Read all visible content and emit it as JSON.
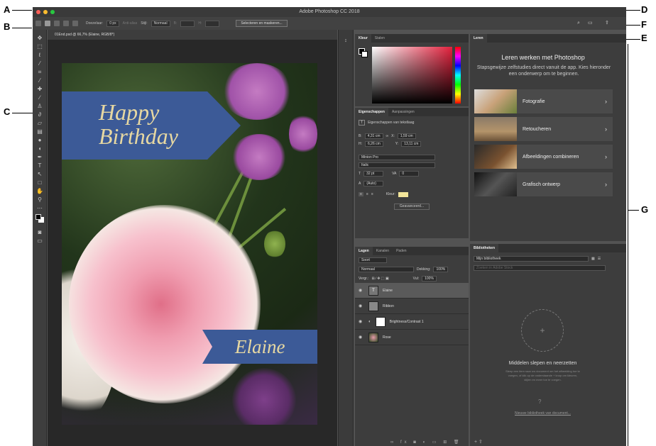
{
  "window": {
    "title": "Adobe Photoshop CC 2018"
  },
  "options_bar": {
    "feather_label": "Doezelaar:",
    "feather_value": "0 px",
    "anti_alias": "Anti-alias",
    "style_label": "Stijl:",
    "style_value": "Normaal",
    "width_label": "B:",
    "height_label": "H:",
    "select_mask": "Selecteren en maskeren..."
  },
  "document": {
    "tab": "01End.psd @ 66,7% (Elaine, RGB/8*)",
    "ribbon_line1": "Happy",
    "ribbon_line2": "Birthday",
    "name_ribbon": "Elaine"
  },
  "color_panel": {
    "tabs": [
      "Kleur",
      "Stalen"
    ]
  },
  "properties_panel": {
    "tabs": [
      "Eigenschappen",
      "Aanpassingen"
    ],
    "header": "Eigenschappen van tekstlaag",
    "w_label": "B:",
    "w_value": "4,31 cm",
    "x_label": "X:",
    "x_value": "1,59 cm",
    "h_label": "H:",
    "h_value": "6,26 cm",
    "y_label": "Y:",
    "y_value": "13,11 cm",
    "font": "Minion Pro",
    "style": "Italic",
    "size": "32 pt",
    "tracking": "0",
    "leading": "(Auto)",
    "color_label": "Kleur:",
    "advanced": "Geavanceerd..."
  },
  "layers_panel": {
    "tabs": [
      "Lagen",
      "Kanalen",
      "Paden"
    ],
    "filter": "Soort",
    "blend": "Normaal",
    "opacity_label": "Dekking:",
    "opacity": "100%",
    "lock_label": "Vergr.:",
    "fill_label": "Vul:",
    "fill": "100%",
    "layers": [
      {
        "name": "Elaine"
      },
      {
        "name": "Ribbon"
      },
      {
        "name": "Brightness/Contrast 1"
      },
      {
        "name": "Rose"
      }
    ]
  },
  "learn_panel": {
    "tab": "Leren",
    "title": "Leren werken met Photoshop",
    "subtitle": "Stapsgewijze zelfstudies direct vanuit de app. Kies hieronder een onderwerp om te beginnen.",
    "items": [
      "Fotografie",
      "Retoucheren",
      "Afbeeldingen combineren",
      "Grafisch ontwerp"
    ]
  },
  "libraries_panel": {
    "tab": "Bibliotheken",
    "library": "Mijn bibliotheek",
    "search_placeholder": "Zoeken in Adobe Stock",
    "drag_title": "Middelen slepen en neerzetten",
    "drag_text": "Sleep een item naar uw document om het afbeelding toe te voegen, of klik op de onderstaande + knop om kleuren, stijlen en meer toe te voegen.",
    "new_from_doc": "Nieuwe bibliotheek van document..."
  },
  "callouts": [
    "A",
    "B",
    "C",
    "D",
    "E",
    "F",
    "G"
  ],
  "colors": {
    "accent": "#3c5a97",
    "ribbon_text": "#e7d8a2",
    "text_color_swatch": "#f2e59a"
  }
}
